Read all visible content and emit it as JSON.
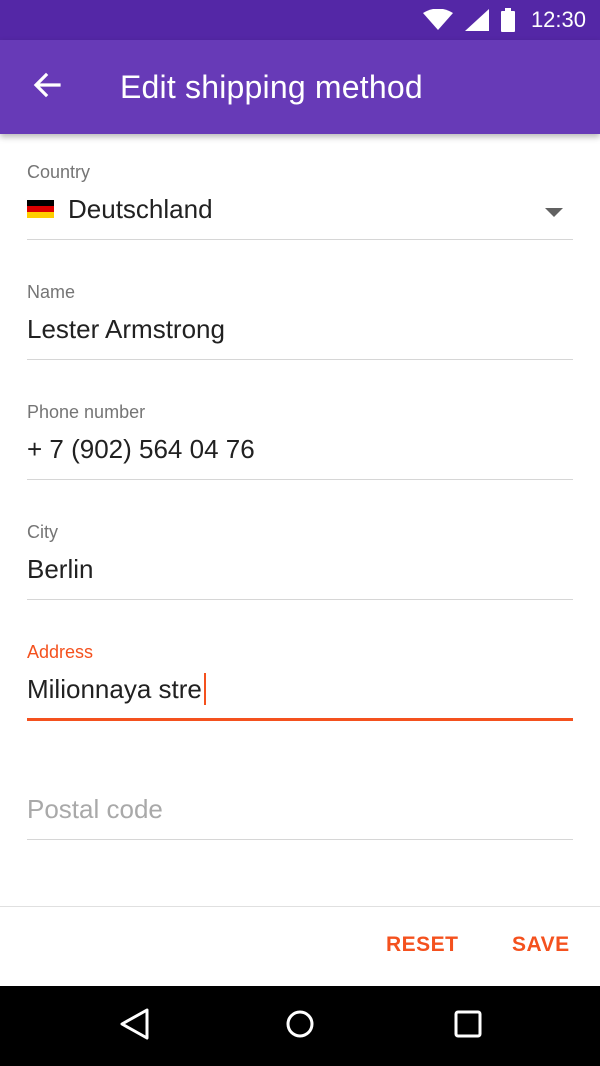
{
  "status_bar": {
    "time": "12:30"
  },
  "app_bar": {
    "title": "Edit shipping method"
  },
  "form": {
    "country": {
      "label": "Country",
      "value": "Deutschland"
    },
    "name": {
      "label": "Name",
      "value": "Lester Armstrong"
    },
    "phone": {
      "label": "Phone number",
      "value": "+ 7 (902) 564 04 76"
    },
    "city": {
      "label": "City",
      "value": "Berlin"
    },
    "address": {
      "label": "Address",
      "value": "Milionnaya stre"
    },
    "postal": {
      "placeholder": "Postal code"
    }
  },
  "actions": {
    "reset_label": "RESET",
    "save_label": "SAVE"
  },
  "colors": {
    "status_bar": "#5427A6",
    "app_bar": "#673AB7",
    "accent": "#F4511E",
    "flag_black": "#000000",
    "flag_red": "#DD0000",
    "flag_gold": "#FFCE00"
  }
}
